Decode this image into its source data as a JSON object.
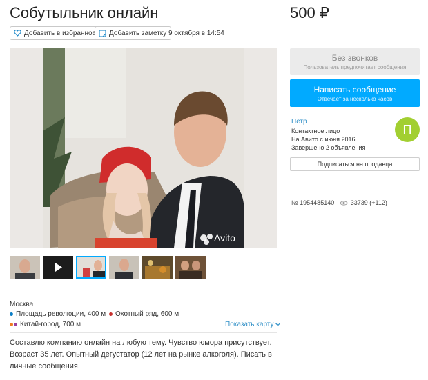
{
  "ad": {
    "title": "Собутыльник онлайн",
    "price": "500 ₽",
    "favorite_label": "Добавить в избранное",
    "note_label": "Добавить заметку",
    "date": "9 октября в 14:54"
  },
  "gallery": {
    "watermark": "Avito",
    "thumbnail_count": 6
  },
  "location": {
    "city": "Москва",
    "metro": [
      {
        "label": "Площадь революции, 400 м",
        "color": "#0c7fc7"
      },
      {
        "label": "Охотный ряд, 600 м",
        "color": "#c7302e"
      },
      {
        "label": "Китай-город, 700 м",
        "color": [
          "#ee7c22",
          "#9b3f9e"
        ]
      }
    ],
    "map_link": "Показать карту"
  },
  "description": "Составлю компанию онлайн на любую тему. Чувство юмора присутствует. Возраст 35 лет. Опытный дегустатор (12 лет на рынке алкоголя). Писать в личные сообщения.",
  "contact": {
    "no_calls_title": "Без звонков",
    "no_calls_sub": "Пользователь предпочитает сообщения",
    "write_title": "Написать сообщение",
    "write_sub": "Отвечает за несколько часов"
  },
  "seller": {
    "name": "Петр",
    "role": "Контактное лицо",
    "since": "На Авито с июня 2016",
    "completed": "Завершено 2 объявления",
    "avatar_letter": "П",
    "subscribe_label": "Подписаться на продавца"
  },
  "stats": {
    "ad_number": "№ 1954485140,",
    "views": "33739 (+112)"
  },
  "colors": {
    "accent": "#01aaff",
    "link": "#2f8fc7",
    "avatar": "#a2cf31"
  }
}
